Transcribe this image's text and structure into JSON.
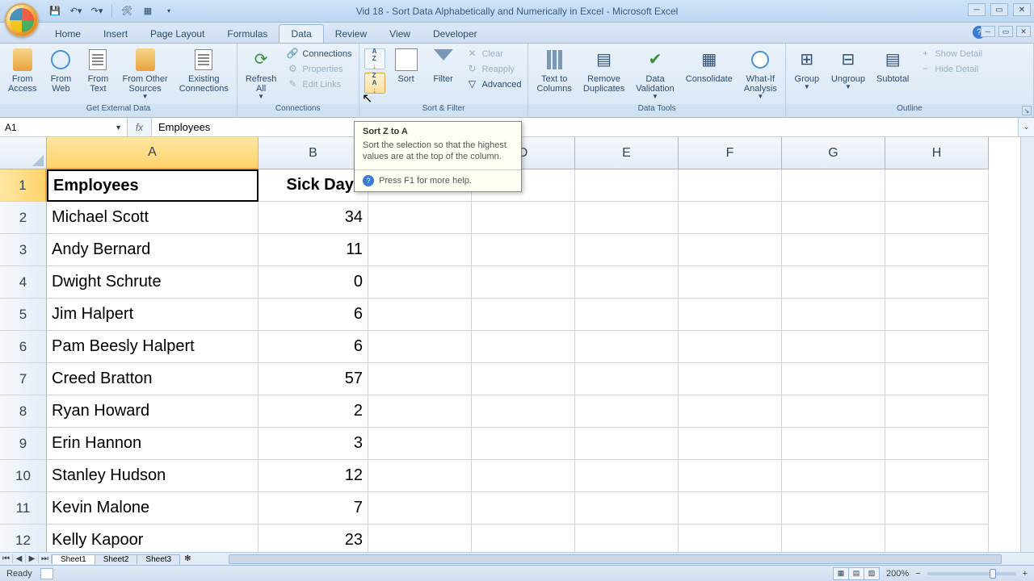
{
  "titlebar": {
    "title": "Vid 18 - Sort Data Alphabetically and Numerically in Excel - Microsoft Excel"
  },
  "tabs": {
    "items": [
      "Home",
      "Insert",
      "Page Layout",
      "Formulas",
      "Data",
      "Review",
      "View",
      "Developer"
    ],
    "active": "Data"
  },
  "ribbon": {
    "g0": {
      "label": "Get External Data",
      "b0": "From\nAccess",
      "b1": "From\nWeb",
      "b2": "From\nText",
      "b3": "From Other\nSources",
      "b4": "Existing\nConnections"
    },
    "g1": {
      "label": "Connections",
      "b0": "Refresh\nAll",
      "c0": "Connections",
      "c1": "Properties",
      "c2": "Edit Links"
    },
    "g2": {
      "label": "Sort & Filter",
      "az": "A\nZ",
      "za": "Z\nA",
      "sort": "Sort",
      "filter": "Filter",
      "clear": "Clear",
      "reapply": "Reapply",
      "advanced": "Advanced"
    },
    "g3": {
      "label": "Data Tools",
      "b0": "Text to\nColumns",
      "b1": "Remove\nDuplicates",
      "b2": "Data\nValidation",
      "b3": "Consolidate",
      "b4": "What-If\nAnalysis"
    },
    "g4": {
      "label": "Outline",
      "b0": "Group",
      "b1": "Ungroup",
      "b2": "Subtotal",
      "c0": "Show Detail",
      "c1": "Hide Detail"
    }
  },
  "namebox": "A1",
  "formula": "Employees",
  "columns": [
    "A",
    "B",
    "C",
    "D",
    "E",
    "F",
    "G",
    "H"
  ],
  "rows": [
    {
      "n": 1,
      "a": "Employees",
      "b": "Sick Days",
      "bold": true
    },
    {
      "n": 2,
      "a": "Michael Scott",
      "b": "34"
    },
    {
      "n": 3,
      "a": "Andy Bernard",
      "b": "11"
    },
    {
      "n": 4,
      "a": "Dwight Schrute",
      "b": "0"
    },
    {
      "n": 5,
      "a": "Jim Halpert",
      "b": "6"
    },
    {
      "n": 6,
      "a": "Pam Beesly Halpert",
      "b": "6"
    },
    {
      "n": 7,
      "a": "Creed Bratton",
      "b": "57"
    },
    {
      "n": 8,
      "a": "Ryan Howard",
      "b": "2"
    },
    {
      "n": 9,
      "a": "Erin Hannon",
      "b": "3"
    },
    {
      "n": 10,
      "a": "Stanley Hudson",
      "b": "12"
    },
    {
      "n": 11,
      "a": "Kevin Malone",
      "b": "7"
    },
    {
      "n": 12,
      "a": "Kelly Kapoor",
      "b": "23"
    }
  ],
  "tooltip": {
    "title": "Sort Z to A",
    "body": "Sort the selection so that the highest values are at the top of the column.",
    "foot": "Press F1 for more help."
  },
  "sheets": [
    "Sheet1",
    "Sheet2",
    "Sheet3"
  ],
  "status": {
    "ready": "Ready",
    "zoom": "200%"
  }
}
